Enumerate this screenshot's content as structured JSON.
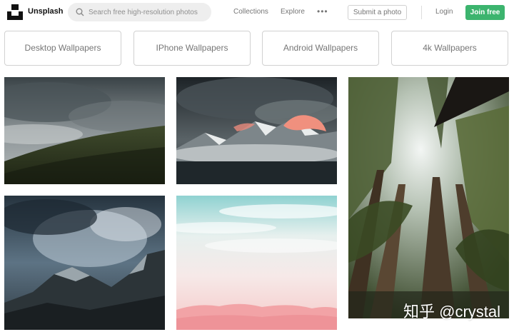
{
  "header": {
    "logo_text": "Unsplash",
    "search_placeholder": "Search free high-resolution photos",
    "nav": {
      "collections": "Collections",
      "explore": "Explore",
      "more_icon": "ellipsis-icon"
    },
    "submit_label": "Submit a photo",
    "login_label": "Login",
    "join_label": "Join free",
    "colors": {
      "join_bg": "#3cb46e",
      "text_muted": "#767676"
    }
  },
  "collections": [
    {
      "label": "Desktop Wallpapers"
    },
    {
      "label": "IPhone Wallpapers"
    },
    {
      "label": "Android Wallpapers"
    },
    {
      "label": "4k Wallpapers"
    }
  ],
  "photos": [
    {
      "subject": "green-hill-under-cloudy-sky"
    },
    {
      "subject": "snow-mountain-at-sunset"
    },
    {
      "subject": "tall-pine-trees-from-below"
    },
    {
      "subject": "dark-mountain-peaks-with-clouds"
    },
    {
      "subject": "pastel-pink-clouds-and-sky"
    }
  ],
  "watermark": "知乎 @crystal"
}
